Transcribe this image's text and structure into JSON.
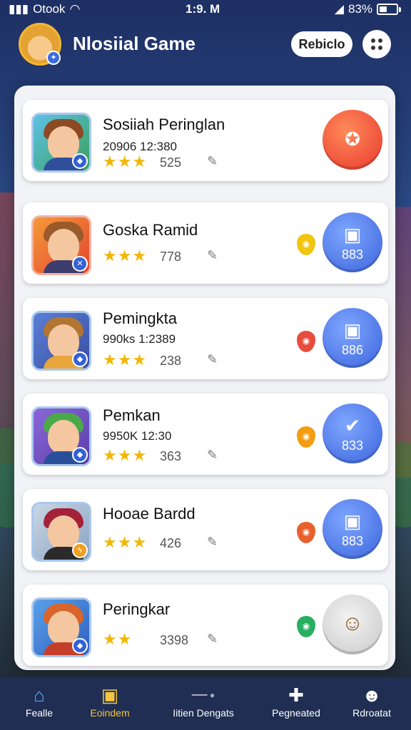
{
  "status": {
    "carrier": "Otook",
    "time": "1:9. M",
    "battery": "83%"
  },
  "header": {
    "title": "Nlosiial Game",
    "profile_label": "Rebiclo"
  },
  "items": [
    {
      "name": "Sosiiah Peringlan",
      "sub": "20906  12:380",
      "stars": "★★★",
      "count": "525",
      "action_value": ""
    },
    {
      "name": "Goska Ramid",
      "sub": "",
      "stars": "★★★",
      "count": "778",
      "action_value": "883"
    },
    {
      "name": "Pemingkta",
      "sub": "990ks 1:2389",
      "stars": "★★★",
      "count": "238",
      "action_value": "886"
    },
    {
      "name": "Pemkan",
      "sub": "9950K  12:30",
      "stars": "★★★",
      "count": "363",
      "action_value": "833"
    },
    {
      "name": "Hooae Bardd",
      "sub": "",
      "stars": "★★★",
      "count": "426",
      "action_value": "883"
    },
    {
      "name": "Peringkar",
      "sub": "",
      "stars": "★★",
      "count": "3398",
      "action_value": ""
    }
  ],
  "nav": [
    {
      "label": "Fealle",
      "icon": "home-icon"
    },
    {
      "label": "Eoindem",
      "icon": "bag-icon"
    },
    {
      "label": "Iitien Dengats",
      "icon": "dot-icon"
    },
    {
      "label": "Pegneated",
      "icon": "puzzle-icon"
    },
    {
      "label": "Rdroatat",
      "icon": "person-icon"
    }
  ],
  "colors": {
    "accent_blue": "#4a78e8",
    "accent_red": "#ef4a3c",
    "nav_bg": "#1f2e52",
    "active_nav": "#f5c542"
  }
}
